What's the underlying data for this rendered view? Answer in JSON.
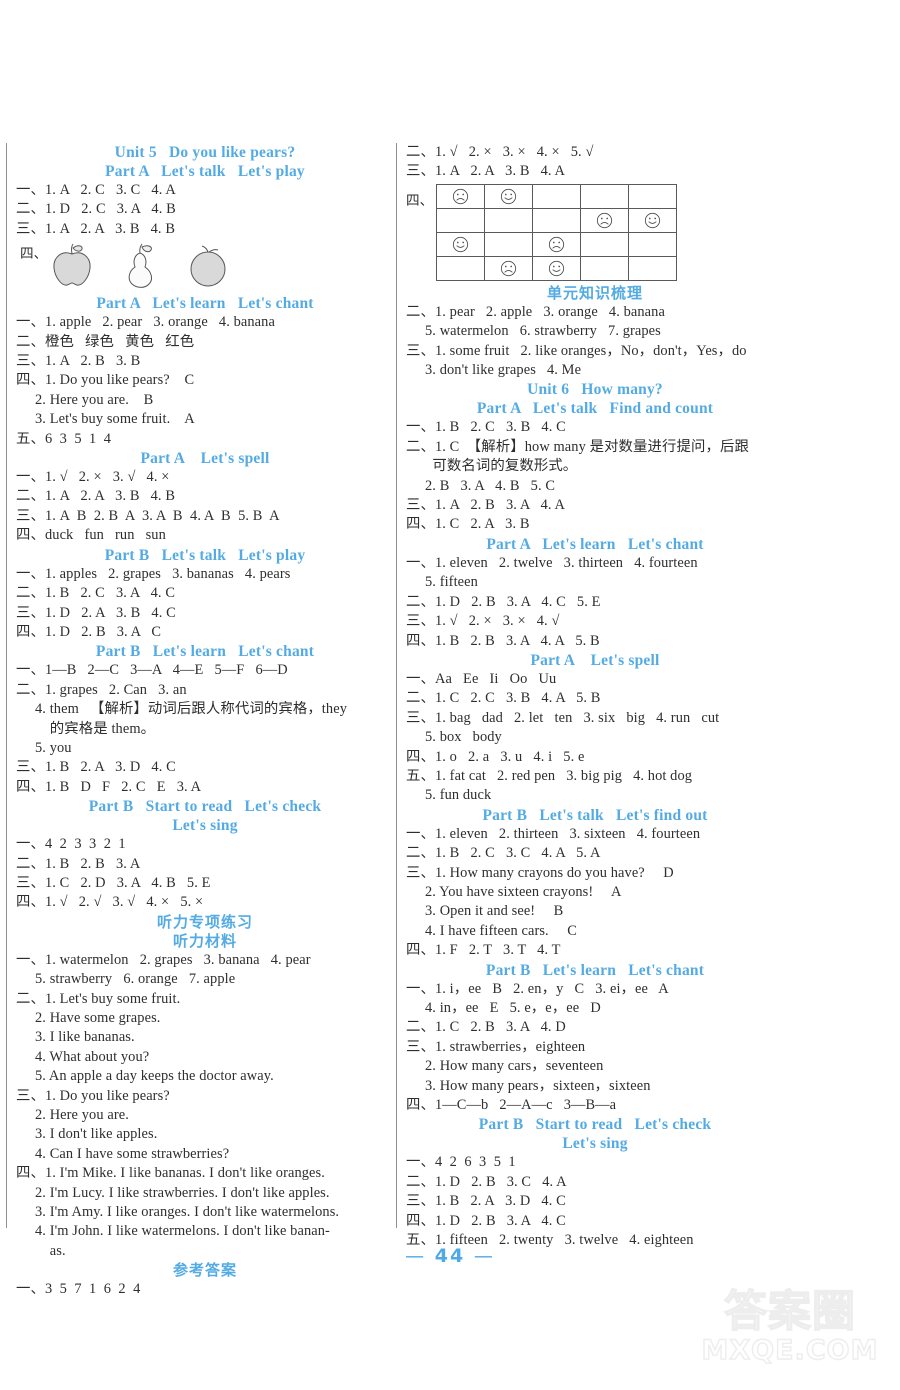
{
  "page": {
    "number": "44",
    "dash_left": "—",
    "dash_right": "—"
  },
  "watermark": {
    "cn": "答案圈",
    "en": "MXQE.COM"
  },
  "left_column": {
    "blocks": [
      {
        "type": "heading",
        "text": "Unit 5   Do you like pears?"
      },
      {
        "type": "heading",
        "text": "Part A   Let's talk   Let's play"
      },
      {
        "type": "line",
        "text": "一、1. A   2. C   3. C   4. A"
      },
      {
        "type": "line",
        "text": "二、1. D   2. C   3. A   4. B"
      },
      {
        "type": "line",
        "text": "三、1. A   2. A   3. B   4. B"
      },
      {
        "type": "fruits",
        "label": "四、",
        "items": [
          "apple-drawing",
          "pear-drawing",
          "orange-drawing"
        ]
      },
      {
        "type": "heading",
        "text": "Part A   Let's learn   Let's chant"
      },
      {
        "type": "line",
        "text": "一、1. apple   2. pear   3. orange   4. banana"
      },
      {
        "type": "line",
        "text": "二、橙色   绿色   黄色   红色"
      },
      {
        "type": "line",
        "text": "三、1. A   2. B   3. B"
      },
      {
        "type": "line",
        "text": "四、1. Do you like pears?    C"
      },
      {
        "type": "line",
        "indent": true,
        "text": "2. Here you are.    B"
      },
      {
        "type": "line",
        "indent": true,
        "text": "3. Let's buy some fruit.    A"
      },
      {
        "type": "line",
        "text": "五、6  3  5  1  4"
      },
      {
        "type": "heading",
        "text": "Part A    Let's spell"
      },
      {
        "type": "line",
        "text": "一、1. √   2. ×   3. √   4. ×"
      },
      {
        "type": "line",
        "text": "二、1. A   2. A   3. B   4. B"
      },
      {
        "type": "line",
        "text": "三、1. A  B  2. B  A  3. A  B  4. A  B  5. B  A"
      },
      {
        "type": "line",
        "text": "四、duck   fun   run   sun"
      },
      {
        "type": "heading",
        "text": "Part B   Let's talk   Let's play"
      },
      {
        "type": "line",
        "text": "一、1. apples   2. grapes   3. bananas   4. pears"
      },
      {
        "type": "line",
        "text": "二、1. B   2. C   3. A   4. C"
      },
      {
        "type": "line",
        "text": "三、1. D   2. A   3. B   4. C"
      },
      {
        "type": "line",
        "text": "四、1. D   2. B   3. A   C"
      },
      {
        "type": "heading",
        "text": "Part B   Let's learn   Let's chant"
      },
      {
        "type": "line",
        "text": "一、1—B   2—C   3—A   4—E   5—F   6—D"
      },
      {
        "type": "line",
        "text": "二、1. grapes   2. Can   3. an"
      },
      {
        "type": "line",
        "indent": true,
        "text": "4. them   【解析】动词后跟人称代词的宾格，they"
      },
      {
        "type": "line",
        "indent": true,
        "text": "    的宾格是 them。"
      },
      {
        "type": "line",
        "indent": true,
        "text": "5. you"
      },
      {
        "type": "line",
        "text": "三、1. B   2. A   3. D   4. C"
      },
      {
        "type": "line",
        "text": "四、1. B   D   F   2. C   E   3. A"
      },
      {
        "type": "heading",
        "text": "Part B   Start to read   Let's check"
      },
      {
        "type": "heading",
        "text": "Let's sing"
      },
      {
        "type": "line",
        "text": "一、4  2  3  3  2  1"
      },
      {
        "type": "line",
        "text": "二、1. B   2. B   3. A"
      },
      {
        "type": "line",
        "text": "三、1. C   2. D   3. A   4. B   5. E"
      },
      {
        "type": "line",
        "text": "四、1. √   2. √   3. √   4. ×   5. ×"
      },
      {
        "type": "heading_cn",
        "text": "听力专项练习"
      },
      {
        "type": "heading_cn",
        "text": "听力材料"
      },
      {
        "type": "line",
        "text": "一、1. watermelon   2. grapes   3. banana   4. pear"
      },
      {
        "type": "line",
        "indent": true,
        "text": "5. strawberry   6. orange   7. apple"
      },
      {
        "type": "line",
        "text": "二、1. Let's buy some fruit."
      },
      {
        "type": "line",
        "indent": true,
        "text": "2. Have some grapes."
      },
      {
        "type": "line",
        "indent": true,
        "text": "3. I like bananas."
      },
      {
        "type": "line",
        "indent": true,
        "text": "4. What about you?"
      },
      {
        "type": "line",
        "indent": true,
        "text": "5. An apple a day keeps the doctor away."
      },
      {
        "type": "line",
        "text": "三、1. Do you like pears?"
      },
      {
        "type": "line",
        "indent": true,
        "text": "2. Here you are."
      },
      {
        "type": "line",
        "indent": true,
        "text": "3. I don't like apples."
      },
      {
        "type": "line",
        "indent": true,
        "text": "4. Can I have some strawberries?"
      },
      {
        "type": "line",
        "text": "四、1. I'm Mike. I like bananas. I don't like oranges."
      },
      {
        "type": "line",
        "indent": true,
        "text": "2. I'm Lucy. I like strawberries. I don't like apples."
      },
      {
        "type": "line",
        "indent": true,
        "text": "3. I'm Amy. I like oranges. I don't like watermelons."
      },
      {
        "type": "line",
        "indent": true,
        "text": "4. I'm John. I like watermelons. I don't like banan-"
      },
      {
        "type": "line",
        "indent": true,
        "text": "    as."
      },
      {
        "type": "heading_cn",
        "text": "参考答案"
      },
      {
        "type": "line",
        "text": "一、3  5  7  1  6  2  4"
      }
    ]
  },
  "right_column": {
    "blocks": [
      {
        "type": "line",
        "text": "二、1. √   2. ×   3. ×   4. ×   5. √"
      },
      {
        "type": "line",
        "text": "三、1. A   2. A   3. B   4. A"
      },
      {
        "type": "grid",
        "label": "四、",
        "rows": [
          [
            "sad",
            "happy",
            "",
            "",
            ""
          ],
          [
            "",
            "",
            "",
            "sad",
            "happy"
          ],
          [
            "happy",
            "",
            "sad",
            "",
            ""
          ],
          [
            "",
            "sad",
            "happy",
            "",
            ""
          ]
        ]
      },
      {
        "type": "heading_cn",
        "text": "单元知识梳理"
      },
      {
        "type": "line",
        "text": "二、1. pear   2. apple   3. orange   4. banana"
      },
      {
        "type": "line",
        "indent": true,
        "text": "5. watermelon   6. strawberry   7. grapes"
      },
      {
        "type": "line",
        "text": "三、1. some fruit   2. like oranges，No，don't，Yes，do"
      },
      {
        "type": "line",
        "indent": true,
        "text": "3. don't like grapes   4. Me"
      },
      {
        "type": "heading",
        "text": "Unit 6   How many?"
      },
      {
        "type": "heading",
        "text": "Part A   Let's talk   Find and count"
      },
      {
        "type": "line",
        "text": "一、1. B   2. C   3. B   4. C"
      },
      {
        "type": "line",
        "text": "二、1. C  【解析】how many 是对数量进行提问，后跟"
      },
      {
        "type": "line",
        "indent": true,
        "text": "  可数名词的复数形式。"
      },
      {
        "type": "line",
        "indent": true,
        "text": "2. B   3. A   4. B   5. C"
      },
      {
        "type": "line",
        "text": "三、1. A   2. B   3. A   4. A"
      },
      {
        "type": "line",
        "text": "四、1. C   2. A   3. B"
      },
      {
        "type": "heading",
        "text": "Part A   Let's learn   Let's chant"
      },
      {
        "type": "line",
        "text": "一、1. eleven   2. twelve   3. thirteen   4. fourteen"
      },
      {
        "type": "line",
        "indent": true,
        "text": "5. fifteen"
      },
      {
        "type": "line",
        "text": "二、1. D   2. B   3. A   4. C   5. E"
      },
      {
        "type": "line",
        "text": "三、1. √   2. ×   3. ×   4. √"
      },
      {
        "type": "line",
        "text": "四、1. B   2. B   3. A   4. A   5. B"
      },
      {
        "type": "heading",
        "text": "Part A    Let's spell"
      },
      {
        "type": "line",
        "text": "一、Aa   Ee   Ii   Oo   Uu"
      },
      {
        "type": "line",
        "text": "二、1. C   2. C   3. B   4. A   5. B"
      },
      {
        "type": "line",
        "text": "三、1. bag   dad   2. let   ten   3. six   big   4. run   cut"
      },
      {
        "type": "line",
        "indent": true,
        "text": "5. box   body"
      },
      {
        "type": "line",
        "text": "四、1. o   2. a   3. u   4. i   5. e"
      },
      {
        "type": "line",
        "text": "五、1. fat cat   2. red pen   3. big pig   4. hot dog"
      },
      {
        "type": "line",
        "indent": true,
        "text": "5. fun duck"
      },
      {
        "type": "heading",
        "text": "Part B   Let's talk   Let's find out"
      },
      {
        "type": "line",
        "text": "一、1. eleven   2. thirteen   3. sixteen   4. fourteen"
      },
      {
        "type": "line",
        "text": "二、1. B   2. C   3. C   4. A   5. A"
      },
      {
        "type": "line",
        "text": "三、1. How many crayons do you have?     D"
      },
      {
        "type": "line",
        "indent": true,
        "text": "2. You have sixteen crayons!     A"
      },
      {
        "type": "line",
        "indent": true,
        "text": "3. Open it and see!     B"
      },
      {
        "type": "line",
        "indent": true,
        "text": "4. I have fifteen cars.     C"
      },
      {
        "type": "line",
        "text": "四、1. F   2. T   3. T   4. T"
      },
      {
        "type": "heading",
        "text": "Part B   Let's learn   Let's chant"
      },
      {
        "type": "line",
        "text": "一、1. i，ee   B   2. en，y   C   3. ei，ee   A"
      },
      {
        "type": "line",
        "indent": true,
        "text": "4. in，ee   E   5. e，e，ee   D"
      },
      {
        "type": "line",
        "text": "二、1. C   2. B   3. A   4. D"
      },
      {
        "type": "line",
        "text": "三、1. strawberries，eighteen"
      },
      {
        "type": "line",
        "indent": true,
        "text": "2. How many cars，seventeen"
      },
      {
        "type": "line",
        "indent": true,
        "text": "3. How many pears，sixteen，sixteen"
      },
      {
        "type": "line",
        "text": "四、1—C—b   2—A—c   3—B—a"
      },
      {
        "type": "heading",
        "text": "Part B   Start to read   Let's check"
      },
      {
        "type": "heading",
        "text": "Let's sing"
      },
      {
        "type": "line",
        "text": "一、4  2  6  3  5  1"
      },
      {
        "type": "line",
        "text": "二、1. D   2. B   3. C   4. A"
      },
      {
        "type": "line",
        "text": "三、1. B   2. A   3. D   4. C"
      },
      {
        "type": "line",
        "text": "四、1. D   2. B   3. A   4. C"
      },
      {
        "type": "line",
        "text": "五、1. fifteen   2. twenty   3. twelve   4. eighteen"
      }
    ]
  },
  "colors": {
    "heading_blue": "#54abe4",
    "page_number_blue": "#4ea9e6",
    "text": "#2e2e2e",
    "rule": "#8f8f8f"
  }
}
